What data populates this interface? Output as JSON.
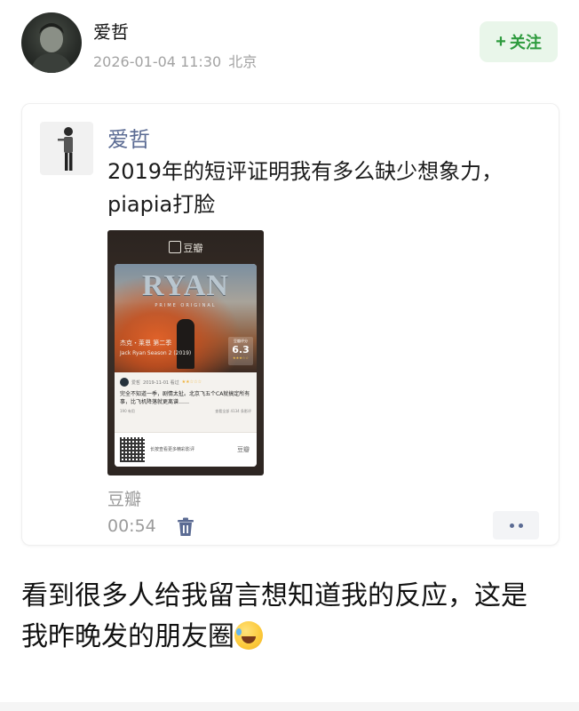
{
  "post": {
    "author": "爱哲",
    "date": "2026-01-04 11:30",
    "location": "北京",
    "follow_label": "关注",
    "body_text": "看到很多人给我留言想知道我的反应，这是我昨晚发的朋友圈"
  },
  "moment": {
    "name": "爱哲",
    "text": "2019年的短评证明我有多么缺少想象力，piapia打脸",
    "source": "豆瓣",
    "time_ago": "00:54",
    "share_card": {
      "app_name": "豆瓣",
      "poster_title": "RYAN",
      "poster_subtitle": "PRIME ORIGINAL",
      "show_title": "杰克・莱恩 第二季",
      "show_title_en": "Jack Ryan Season 2 (2019)",
      "rating_label": "豆瓣评分",
      "rating": "6.3",
      "rating_stars": "★★★☆☆",
      "reviewer": "爱哲",
      "review_meta": "2019-11-01 看过",
      "review_stars": "★★☆☆☆",
      "review_text": "完全不知道一季，剧情太扯。北京飞五个CA就搞定所有事，比飞机降落就更离谱……",
      "review_footer_left": "190 有用",
      "review_footer_right": "查看全部 4134 条影评",
      "qr_text": "长按查看更多精彩影评",
      "brand": "豆瓣"
    }
  },
  "colors": {
    "accent_green": "#2e9b3e",
    "follow_bg": "#e9f6ea",
    "moment_name": "#5b6b93",
    "muted": "#9b9b9b"
  },
  "icons": {
    "follow": "plus-icon",
    "delete": "trash-icon",
    "more": "more-dots-icon"
  }
}
